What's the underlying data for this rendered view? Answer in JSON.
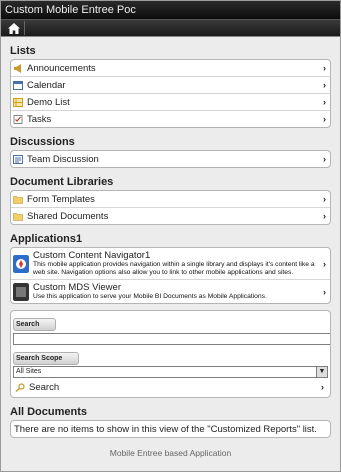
{
  "app": {
    "title": "Custom Mobile Entree Poc"
  },
  "lists": {
    "title": "Lists",
    "items": [
      {
        "label": "Announcements",
        "icon": "megaphone-icon"
      },
      {
        "label": "Calendar",
        "icon": "calendar-icon"
      },
      {
        "label": "Demo List",
        "icon": "list-icon"
      },
      {
        "label": "Tasks",
        "icon": "tasks-icon"
      }
    ]
  },
  "discussions": {
    "title": "Discussions",
    "items": [
      {
        "label": "Team Discussion",
        "icon": "discussion-icon"
      }
    ]
  },
  "libraries": {
    "title": "Document Libraries",
    "items": [
      {
        "label": "Form Templates",
        "icon": "folder-icon"
      },
      {
        "label": "Shared Documents",
        "icon": "folder-icon"
      }
    ]
  },
  "applications": {
    "title": "Applications1",
    "items": [
      {
        "title": "Custom Content Navigator1",
        "desc": "This mobile application provides navigation within a single library and displays it's content like a web site. Navigation options also allow you to link to other mobile applications and sites."
      },
      {
        "title": "Custom MDS Viewer",
        "desc": "Use this application to serve your Mobile BI Documents as Mobile Applications."
      }
    ]
  },
  "search": {
    "label": "Search",
    "scope_label": "Search Scope",
    "scope_value": "All Sites",
    "button_label": "Search"
  },
  "all_documents": {
    "title": "All Documents",
    "empty_text": "There are no items to show in this view of the \"Customized Reports\" list."
  },
  "footer": "Mobile Entree based Application"
}
